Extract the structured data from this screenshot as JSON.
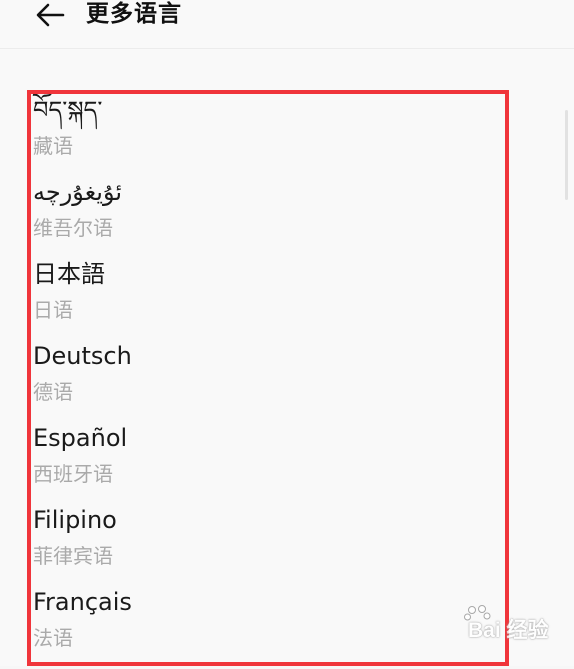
{
  "header": {
    "title": "更多语言",
    "back_icon": "arrow-left-icon"
  },
  "languages": [
    {
      "name": "བོད་སྐད་",
      "sub": "藏语"
    },
    {
      "name": "ئۇيغۇرچە",
      "sub": "维吾尔语"
    },
    {
      "name": "日本語",
      "sub": "日语"
    },
    {
      "name": "Deutsch",
      "sub": "德语"
    },
    {
      "name": "Español",
      "sub": "西班牙语"
    },
    {
      "name": "Filipino",
      "sub": "菲律宾语"
    },
    {
      "name": "Français",
      "sub": "法语"
    }
  ],
  "highlight": {
    "color": "#f0353b"
  },
  "watermark": {
    "text": "Bai 经验"
  }
}
